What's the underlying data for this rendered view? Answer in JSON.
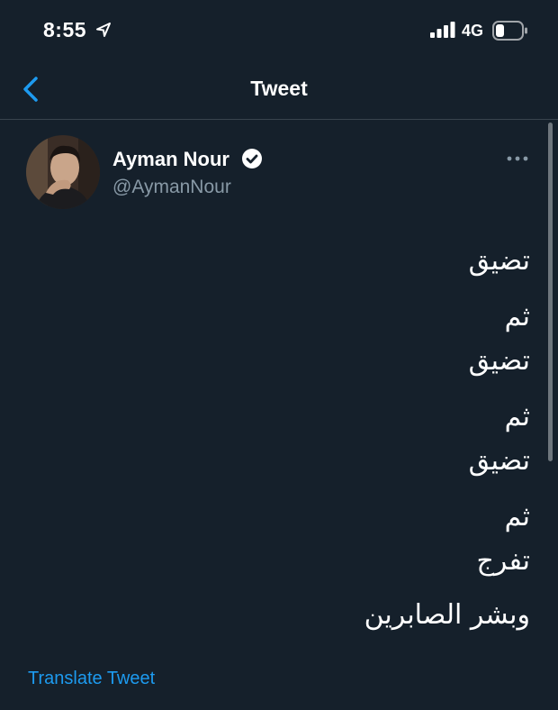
{
  "status_bar": {
    "time": "8:55",
    "network": "4G",
    "location_icon": "location-arrow-icon",
    "signal_icon": "signal-bars-icon",
    "battery_icon": "battery-icon"
  },
  "nav": {
    "title": "Tweet",
    "back_icon": "chevron-left-icon"
  },
  "tweet": {
    "author": {
      "name": "Ayman Nour",
      "handle": "@AymanNour",
      "verified": true
    },
    "lines": [
      "تضيق",
      "ثم",
      "تضيق",
      "ثم",
      "تضيق",
      "ثم",
      "تفرج",
      "وبشر الصابرين"
    ],
    "translate_label": "Translate Tweet",
    "more_icon": "more-dots-icon"
  },
  "colors": {
    "background": "#15202b",
    "accent": "#1d9bf0",
    "secondary_text": "#8899a6",
    "divider": "#38444d"
  }
}
